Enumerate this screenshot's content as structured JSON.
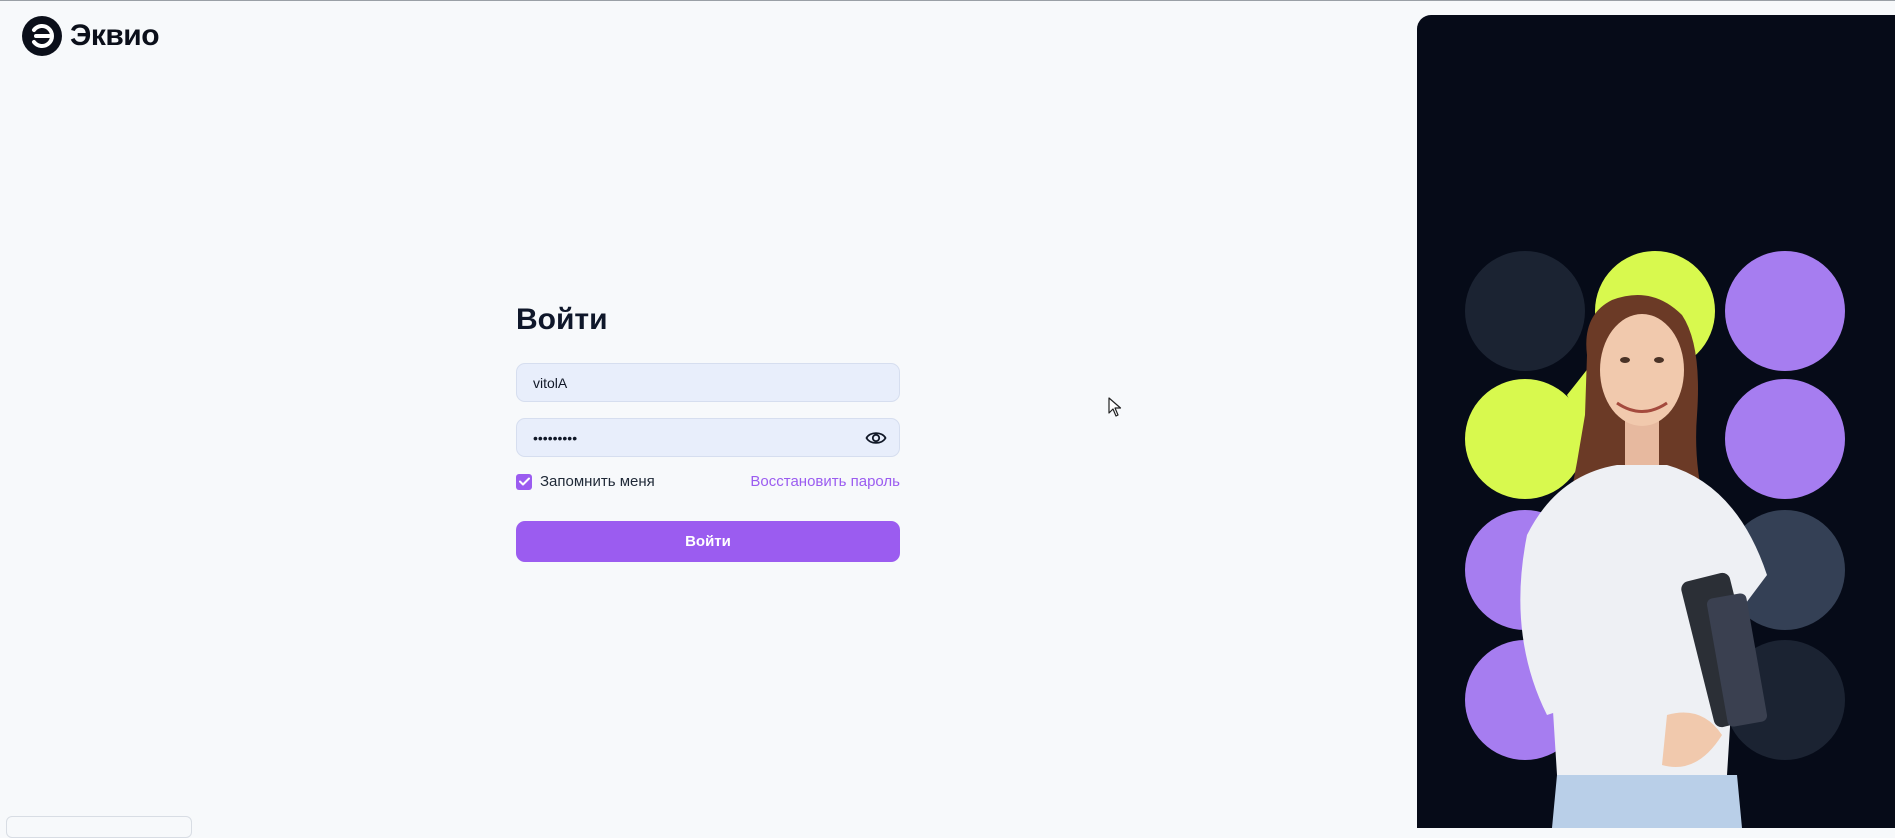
{
  "brand": {
    "name": "Эквио"
  },
  "login": {
    "title": "Войти",
    "username_value": "vitolA",
    "password_value": "vitolA123",
    "remember_label": "Запомнить меня",
    "remember_checked": true,
    "restore_link": "Восстановить пароль",
    "submit_label": "Войти"
  },
  "icons": {
    "logo": "equio-logo-icon",
    "show_password": "eye-icon",
    "checkbox": "check-icon",
    "cursor": "mouse-pointer-icon"
  },
  "colors": {
    "accent": "#9b5cf0",
    "page_bg": "#f7f9fb",
    "field_bg": "#e8eefb",
    "promo_bg": "#060b18",
    "lime": "#d8f94e",
    "lilac": "#a67df0",
    "navy": "#1b2332",
    "slate": "#344055"
  }
}
